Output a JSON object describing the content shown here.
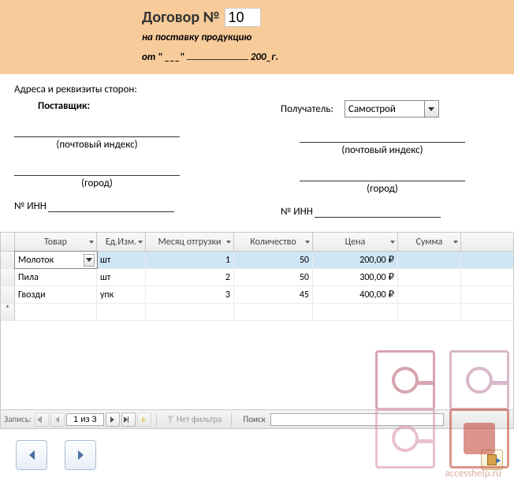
{
  "banner": {
    "title_prefix": "Договор №",
    "number": "10",
    "subtitle": "на поставку продукцию",
    "date_prefix": "от \" ___\"",
    "date_suffix": "200_г."
  },
  "addresses": {
    "heading": "Адреса и реквизиты сторон:",
    "supplier_label": "Поставщик:",
    "recipient_label": "Получатель:",
    "recipient_value": "Самострой",
    "postal_hint": "(почтовый индекс)",
    "city_hint": "(город)",
    "inn_label": "№ ИНН"
  },
  "grid": {
    "columns": [
      "Товар",
      "Ед.Изм.",
      "Месяц отгрузки",
      "Количество",
      "Цена",
      "Сумма"
    ],
    "rows": [
      {
        "product": "Молоток",
        "unit": "шт",
        "month": "1",
        "qty": "50",
        "price": "200,00 ₽",
        "sum": "",
        "selected": true
      },
      {
        "product": "Пила",
        "unit": "шт",
        "month": "2",
        "qty": "50",
        "price": "300,00 ₽",
        "sum": ""
      },
      {
        "product": "Гвозди",
        "unit": "упк",
        "month": "3",
        "qty": "45",
        "price": "400,00 ₽",
        "sum": ""
      }
    ]
  },
  "nav": {
    "record_label": "Запись:",
    "position": "1 из 3",
    "no_filter": "Нет фильтра",
    "search_label": "Поиск"
  },
  "watermark_url": "accesshelp.ru"
}
